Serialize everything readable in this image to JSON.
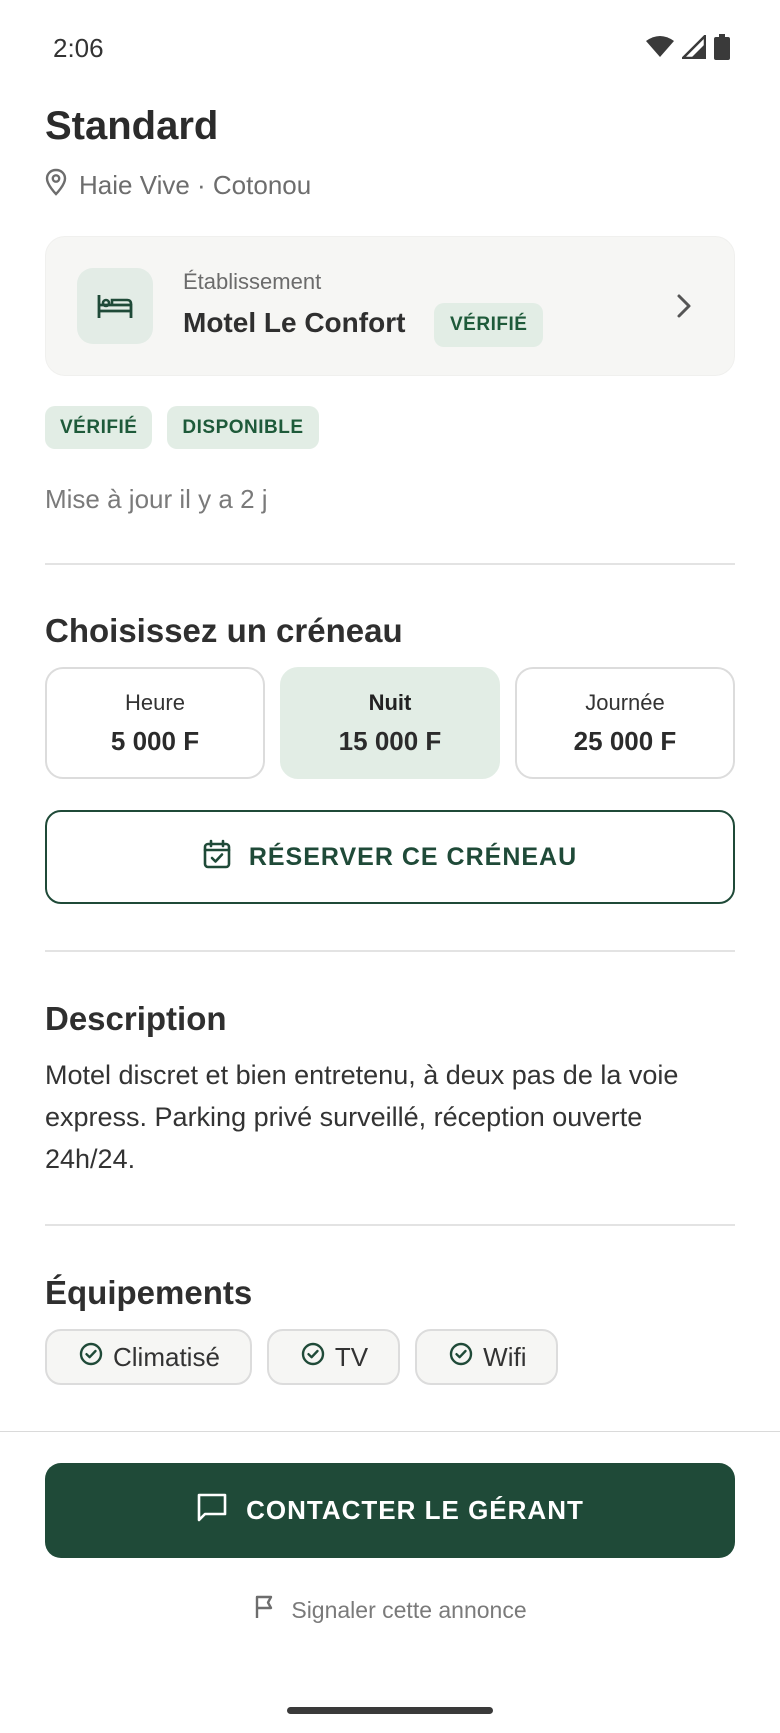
{
  "status_bar": {
    "time": "2:06",
    "icons": [
      "wifi-icon",
      "signal-icon",
      "battery-icon"
    ]
  },
  "room": {
    "title": "Standard",
    "location": "Haie Vive · Cotonou",
    "location_icon": "map-pin-icon"
  },
  "establishment": {
    "label": "Établissement",
    "name": "Motel Le Confort",
    "badge": "VÉRIFIÉ",
    "icon": "bed-icon",
    "chevron_icon": "chevron-right-icon"
  },
  "badges": [
    "VÉRIFIÉ",
    "DISPONIBLE"
  ],
  "updated": "Mise à jour il y a 2 j",
  "slots_section": {
    "title": "Choisissez un créneau",
    "slots": [
      {
        "name": "Heure",
        "price": "5 000 F",
        "selected": false
      },
      {
        "name": "Nuit",
        "price": "15 000 F",
        "selected": true
      },
      {
        "name": "Journée",
        "price": "25 000 F",
        "selected": false
      }
    ],
    "reserve_label": "RÉSERVER CE CRÉNEAU",
    "reserve_icon": "calendar-check-icon"
  },
  "description": {
    "title": "Description",
    "text": "Motel discret et bien entretenu, à deux pas de la voie express. Parking privé surveillé, réception ouverte 24h/24."
  },
  "amenities": {
    "title": "Équipements",
    "items": [
      "Climatisé",
      "TV",
      "Wifi"
    ],
    "item_icon": "check-circle-icon"
  },
  "actions": {
    "contact_label": "CONTACTER LE GÉRANT",
    "contact_icon": "message-icon",
    "report_label": "Signaler cette annonce",
    "report_icon": "flag-icon"
  },
  "colors": {
    "primary": "#1f4a38",
    "badge_bg": "#e2ede5",
    "badge_text": "#1e5a3a",
    "card_bg": "#f6f6f4"
  }
}
